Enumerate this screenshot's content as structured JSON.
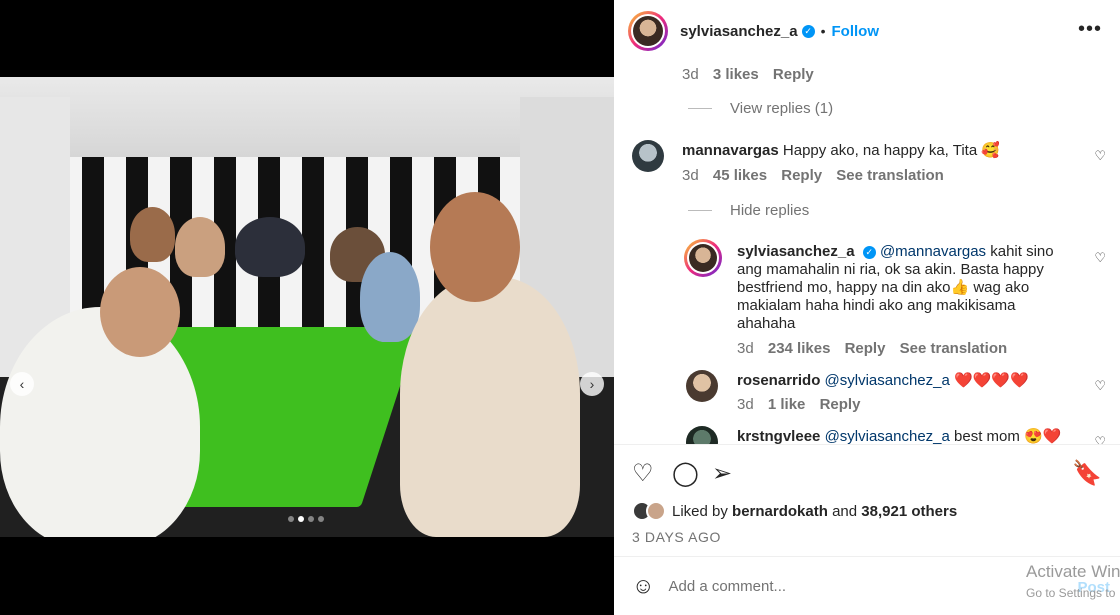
{
  "post": {
    "username": "sylviasanchez_a",
    "follow_label": "Follow",
    "separator": "•",
    "more_label": "•••"
  },
  "media": {
    "prev_label": "‹",
    "next_label": "›",
    "slide_count": 4,
    "active_slide": 2
  },
  "comments": {
    "top_meta": {
      "time": "3d",
      "likes": "3 likes",
      "reply": "Reply"
    },
    "view_replies": "View replies (1)",
    "c1": {
      "username": "mannavargas",
      "text": "Happy ako, na happy ka, Tita 🥰",
      "time": "3d",
      "likes": "45 likes",
      "reply": "Reply",
      "translation": "See translation"
    },
    "hide_replies": "Hide replies",
    "r1": {
      "username": "sylviasanchez_a",
      "mention": "@mannavargas",
      "text": "kahit sino ang mamahalin ni ria, ok sa akin. Basta happy bestfriend mo, happy na din ako👍 wag ako makialam haha hindi ako ang makikisama ahahaha",
      "time": "3d",
      "likes": "234 likes",
      "reply": "Reply",
      "translation": "See translation"
    },
    "r2": {
      "username": "rosenarrido",
      "mention": "@sylviasanchez_a",
      "text": "❤️❤️❤️❤️",
      "time": "3d",
      "likes": "1 like",
      "reply": "Reply"
    },
    "r3": {
      "username": "krstngvleee",
      "mention": "@sylviasanchez_a",
      "text": "best mom 😍❤️"
    }
  },
  "actions": {
    "like_icon": "heart-icon",
    "comment_icon": "comment-icon",
    "share_icon": "share-icon",
    "save_icon": "bookmark-icon",
    "liked_by_prefix": "Liked by",
    "liked_by_user": "bernardokath",
    "liked_by_and": "and",
    "liked_by_others": "38,921 others",
    "date": "3 DAYS AGO"
  },
  "comment_box": {
    "placeholder": "Add a comment...",
    "post_label": "Post"
  },
  "watermark": {
    "line1": "Activate Win",
    "line2": "Go to Settings to"
  },
  "colors": {
    "accent": "#0095f6",
    "table_green": "#3fbf1f"
  }
}
